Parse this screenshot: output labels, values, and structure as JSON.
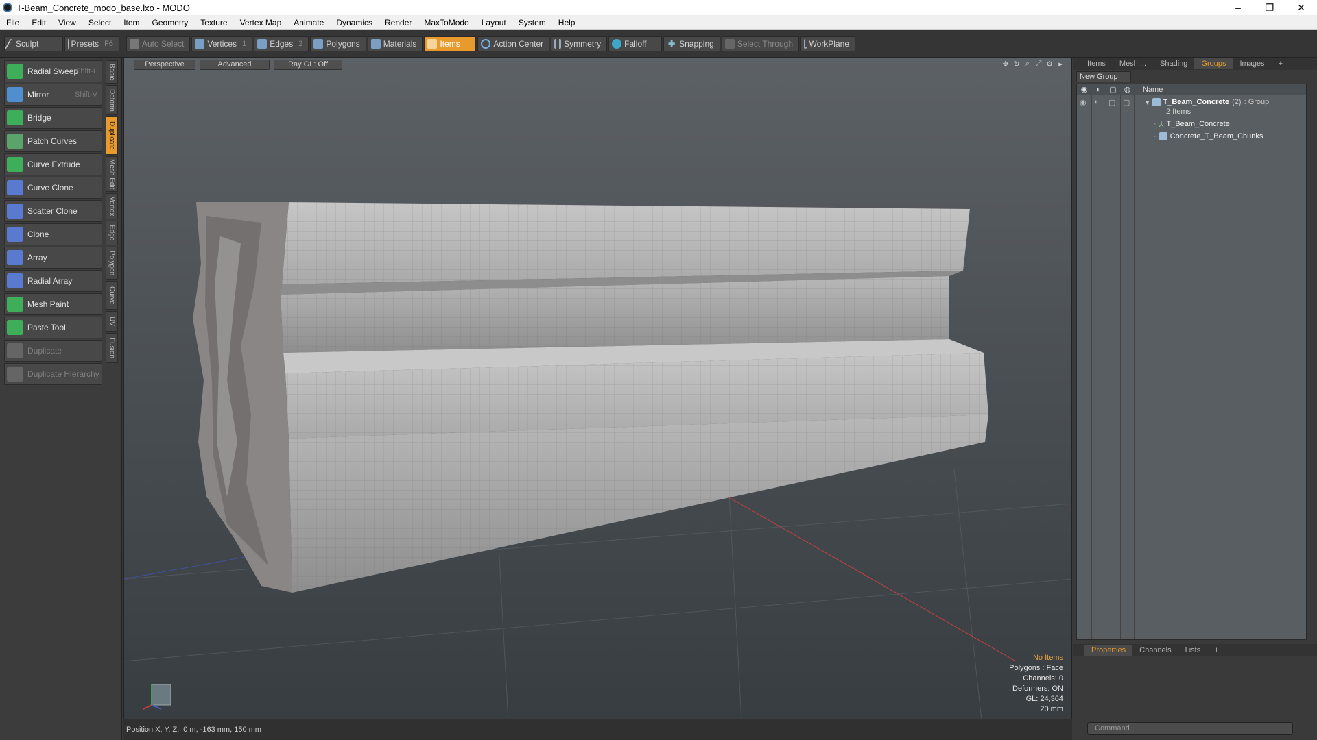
{
  "window": {
    "title": "T-Beam_Concrete_modo_base.lxo - MODO",
    "min": "–",
    "max": "❐",
    "close": "✕"
  },
  "menu": [
    "File",
    "Edit",
    "View",
    "Select",
    "Item",
    "Geometry",
    "Texture",
    "Vertex Map",
    "Animate",
    "Dynamics",
    "Render",
    "MaxToModo",
    "Layout",
    "System",
    "Help"
  ],
  "toolbar": {
    "sculpt": "Sculpt",
    "presets": "Presets",
    "presets_key": "F6",
    "auto_select": "Auto Select",
    "vertices": "Vertices",
    "vertices_count": "1",
    "edges": "Edges",
    "edges_count": "2",
    "polygons": "Polygons",
    "materials": "Materials",
    "items": "Items",
    "action_center": "Action Center",
    "symmetry": "Symmetry",
    "falloff": "Falloff",
    "snapping": "Snapping",
    "select_through": "Select Through",
    "workplane": "WorkPlane"
  },
  "tools": [
    {
      "label": "Radial Sweep",
      "key": "Shift-L",
      "icon": "radial-sweep-icon",
      "color": "#3fae5a",
      "disabled": false
    },
    {
      "label": "Mirror",
      "key": "Shift-V",
      "icon": "mirror-icon",
      "color": "#4f8fd0",
      "disabled": false
    },
    {
      "label": "Bridge",
      "key": "",
      "icon": "bridge-icon",
      "color": "#3fae5a",
      "disabled": false
    },
    {
      "label": "Patch Curves",
      "key": "",
      "icon": "patch-curves-icon",
      "color": "#5aa36a",
      "disabled": false
    },
    {
      "label": "Curve Extrude",
      "key": "",
      "icon": "curve-extrude-icon",
      "color": "#3fae5a",
      "disabled": false
    },
    {
      "label": "Curve Clone",
      "key": "",
      "icon": "curve-clone-icon",
      "color": "#5a7ad0",
      "disabled": false
    },
    {
      "label": "Scatter Clone",
      "key": "",
      "icon": "scatter-clone-icon",
      "color": "#5a7ad0",
      "disabled": false
    },
    {
      "label": "Clone",
      "key": "",
      "icon": "clone-icon",
      "color": "#5a7ad0",
      "disabled": false
    },
    {
      "label": "Array",
      "key": "",
      "icon": "array-icon",
      "color": "#5a7ad0",
      "disabled": false
    },
    {
      "label": "Radial Array",
      "key": "",
      "icon": "radial-array-icon",
      "color": "#5a7ad0",
      "disabled": false
    },
    {
      "label": "Mesh Paint",
      "key": "",
      "icon": "mesh-paint-icon",
      "color": "#3fae5a",
      "disabled": false
    },
    {
      "label": "Paste Tool",
      "key": "",
      "icon": "paste-tool-icon",
      "color": "#3fae5a",
      "disabled": false
    },
    {
      "label": "Duplicate",
      "key": "",
      "icon": "duplicate-icon",
      "color": "#8a8a8a",
      "disabled": true
    },
    {
      "label": "Duplicate Hierarchy",
      "key": "",
      "icon": "duplicate-hierarchy-icon",
      "color": "#8a8a8a",
      "disabled": true
    }
  ],
  "vtabs": [
    {
      "label": "Basic",
      "active": false
    },
    {
      "label": "Deform",
      "active": false
    },
    {
      "label": "Duplicate",
      "active": true
    },
    {
      "label": "Mesh Edit",
      "active": false
    },
    {
      "label": "Vertex",
      "active": false
    },
    {
      "label": "Edge",
      "active": false
    },
    {
      "label": "Polygon",
      "active": false
    },
    {
      "label": "Curve",
      "active": false
    },
    {
      "label": "UV",
      "active": false
    },
    {
      "label": "Fusion",
      "active": false
    }
  ],
  "viewport": {
    "view": "Perspective",
    "mode": "Advanced",
    "raygl": "Ray GL: Off",
    "info": {
      "no_items": "No Items",
      "polygons": "Polygons : Face",
      "channels": "Channels: 0",
      "deformers": "Deformers: ON",
      "gl": "GL: 24,364",
      "scale": "20 mm"
    }
  },
  "status": {
    "position_label": "Position X, Y, Z:",
    "position_value": "0 m, -163 mm, 150 mm"
  },
  "right": {
    "tabs": [
      {
        "label": "Items",
        "active": false
      },
      {
        "label": "Mesh ...",
        "active": false
      },
      {
        "label": "Shading",
        "active": false
      },
      {
        "label": "Groups",
        "active": true
      },
      {
        "label": "Images",
        "active": false
      },
      {
        "label": "+",
        "active": false
      }
    ],
    "new_group": "New Group",
    "col_name": "Name",
    "group": {
      "name": "T_Beam_Concrete",
      "count": "(2)",
      "type": ": Group",
      "sub": "2 Items"
    },
    "children": [
      "T_Beam_Concrete",
      "Concrete_T_Beam_Chunks"
    ],
    "bottom_tabs": [
      {
        "label": "Properties",
        "active": true
      },
      {
        "label": "Channels",
        "active": false
      },
      {
        "label": "Lists",
        "active": false
      },
      {
        "label": "+",
        "active": false
      }
    ],
    "command_placeholder": "Command"
  }
}
